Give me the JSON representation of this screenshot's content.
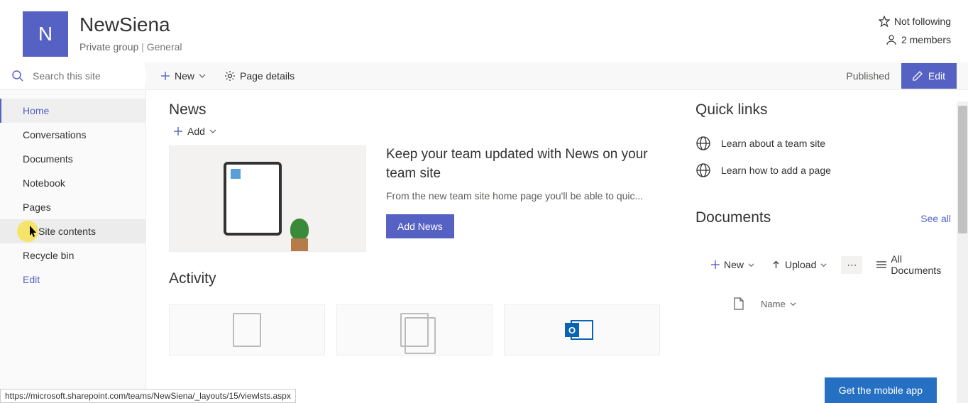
{
  "site": {
    "logo_letter": "N",
    "title": "NewSiena",
    "privacy": "Private group",
    "category": "General"
  },
  "header_right": {
    "follow": "Not following",
    "members": "2 members"
  },
  "search": {
    "placeholder": "Search this site"
  },
  "cmdbar": {
    "new": "New",
    "page_details": "Page details",
    "published": "Published",
    "edit": "Edit"
  },
  "nav": {
    "items": [
      {
        "label": "Home"
      },
      {
        "label": "Conversations"
      },
      {
        "label": "Documents"
      },
      {
        "label": "Notebook"
      },
      {
        "label": "Pages"
      },
      {
        "label": "Site contents"
      },
      {
        "label": "Recycle bin"
      },
      {
        "label": "Edit"
      }
    ]
  },
  "news": {
    "title": "News",
    "add": "Add",
    "headline": "Keep your team updated with News on your team site",
    "desc": "From the new team site home page you'll be able to quic...",
    "button": "Add News"
  },
  "activity": {
    "title": "Activity"
  },
  "quicklinks": {
    "title": "Quick links",
    "items": [
      {
        "label": "Learn about a team site"
      },
      {
        "label": "Learn how to add a page"
      }
    ]
  },
  "documents": {
    "title": "Documents",
    "see_all": "See all",
    "cmd_new": "New",
    "cmd_upload": "Upload",
    "cmd_all": "All Documents",
    "col_name": "Name"
  },
  "mobile": {
    "label": "Get the mobile app"
  },
  "status": {
    "url": "https://microsoft.sharepoint.com/teams/NewSiena/_layouts/15/viewlsts.aspx"
  }
}
